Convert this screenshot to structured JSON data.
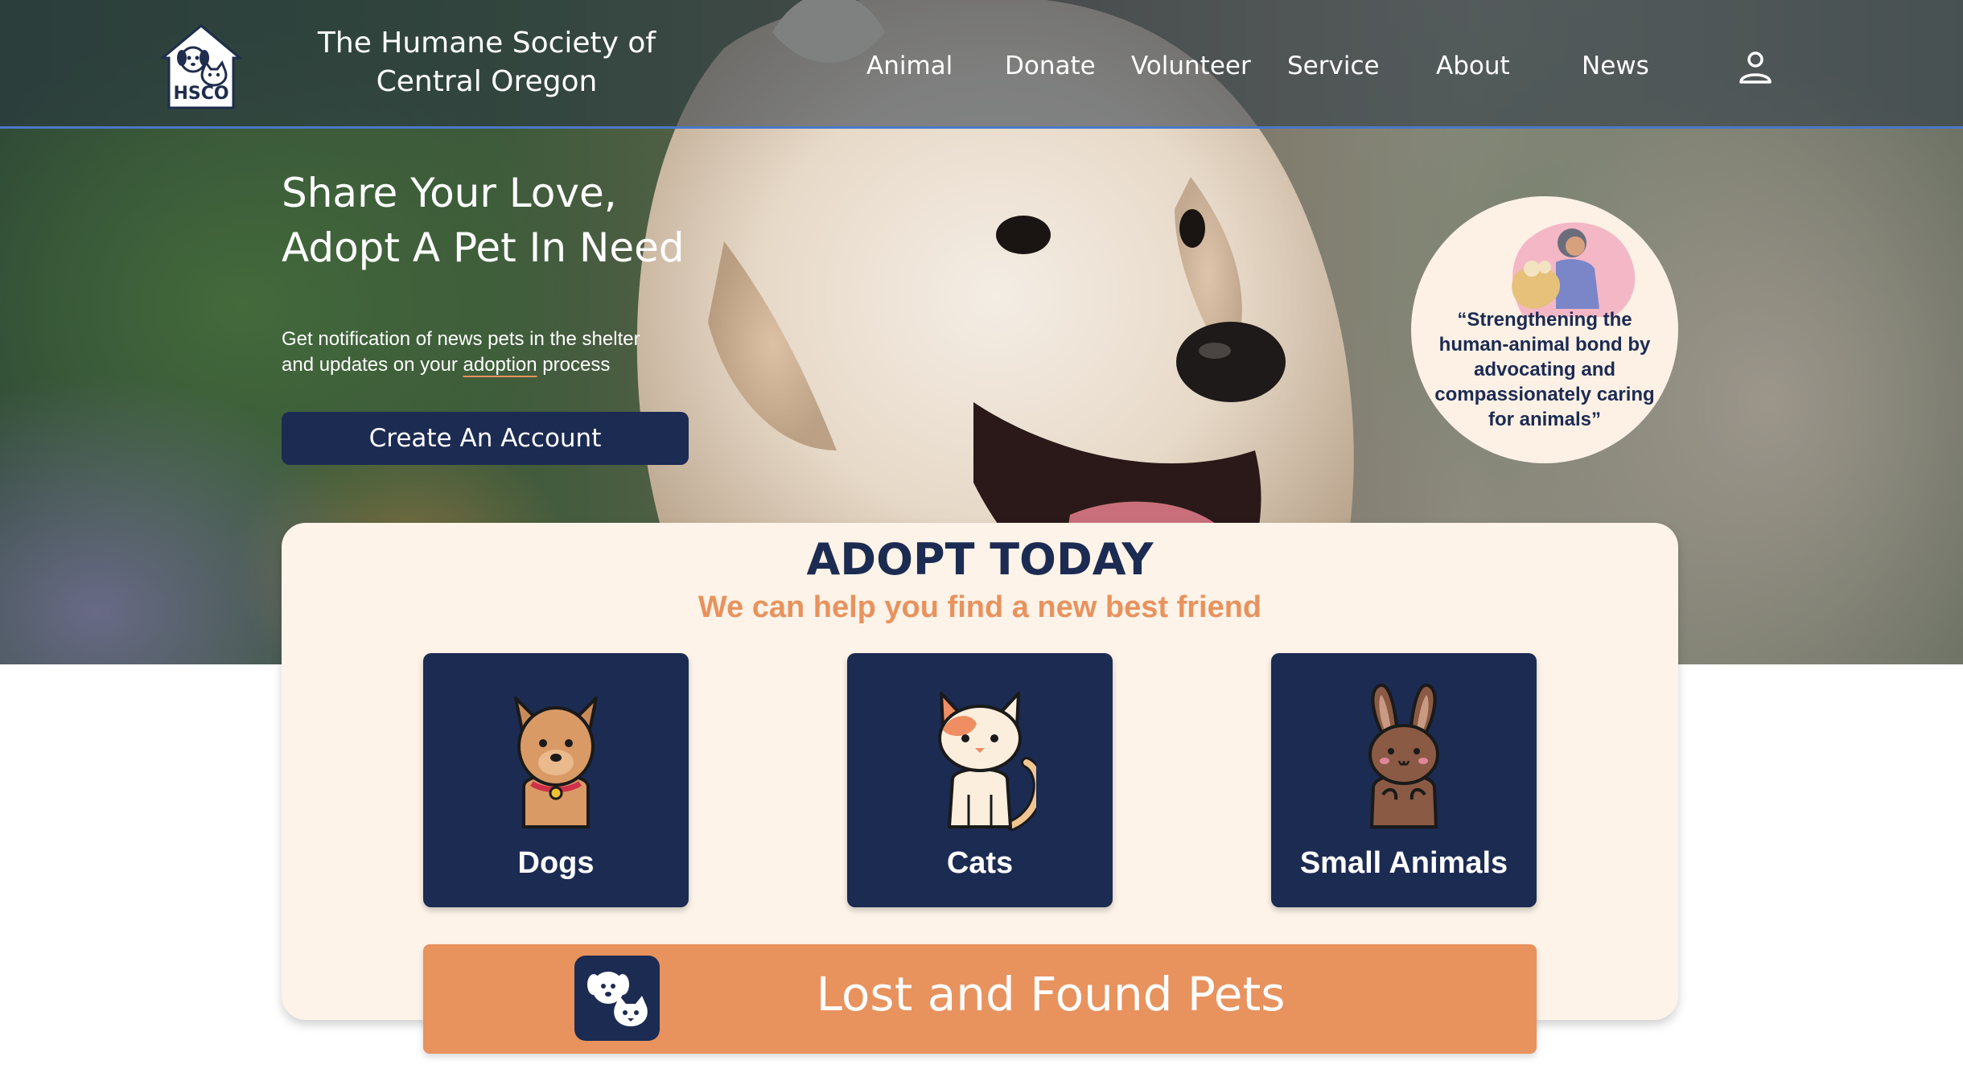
{
  "header": {
    "logo_text": "HSCO",
    "org_name": "The Humane Society of Central Oregon",
    "nav": [
      "Animal",
      "Donate",
      "Volunteer",
      "Service",
      "About",
      "News"
    ],
    "user_icon": "user-icon"
  },
  "hero": {
    "headline_line1": "Share Your Love,",
    "headline_line2": "Adopt A Pet In Need",
    "subtext_line1": "Get notification of news pets in the shelter",
    "subtext_line2_pre": "and updates on your ",
    "subtext_line2_link": "adoption",
    "subtext_line2_post": " process",
    "cta_label": "Create An Account",
    "mission": "“Strengthening the human-animal bond by advocating and compassionately caring for animals”"
  },
  "adopt": {
    "title": "ADOPT TODAY",
    "subtitle": "We can help you find a new best friend",
    "categories": [
      {
        "label": "Dogs",
        "icon": "dog-icon"
      },
      {
        "label": "Cats",
        "icon": "cat-icon"
      },
      {
        "label": "Small Animals",
        "icon": "rabbit-icon"
      }
    ],
    "lost_found_label": "Lost and Found Pets",
    "lost_found_icon": "dog-cat-icon"
  },
  "colors": {
    "navy": "#1c2b52",
    "orange": "#e8925e",
    "cream": "#fdf3e8"
  }
}
